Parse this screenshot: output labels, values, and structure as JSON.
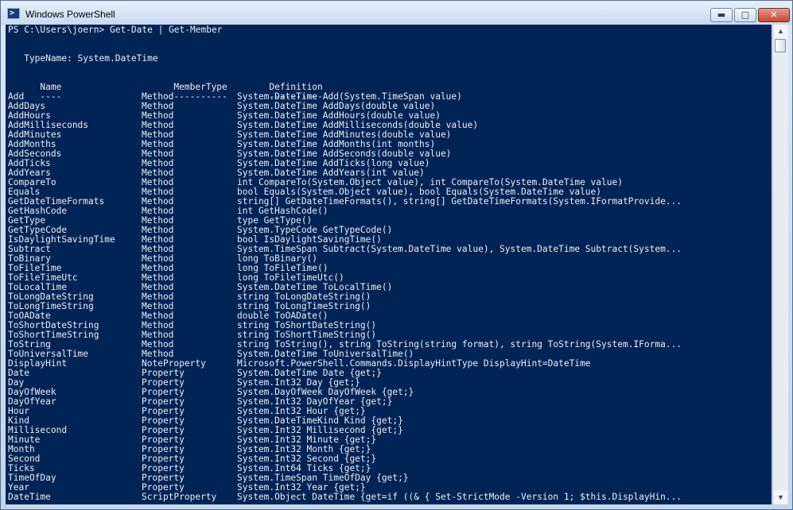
{
  "window": {
    "title": "Windows PowerShell",
    "icon": "powershell-icon",
    "controls": {
      "minimize": "▬",
      "maximize": "□",
      "close": "✕"
    }
  },
  "console": {
    "prompt": "PS C:\\Users\\joern> Get-Date | Get-Member",
    "typename": "   TypeName: System.DateTime",
    "headers": [
      "Name",
      "MemberType",
      "Definition"
    ],
    "underline": [
      "----",
      "----------",
      "----------"
    ],
    "rows": [
      [
        "Add",
        "Method",
        "System.DateTime Add(System.TimeSpan value)"
      ],
      [
        "AddDays",
        "Method",
        "System.DateTime AddDays(double value)"
      ],
      [
        "AddHours",
        "Method",
        "System.DateTime AddHours(double value)"
      ],
      [
        "AddMilliseconds",
        "Method",
        "System.DateTime AddMilliseconds(double value)"
      ],
      [
        "AddMinutes",
        "Method",
        "System.DateTime AddMinutes(double value)"
      ],
      [
        "AddMonths",
        "Method",
        "System.DateTime AddMonths(int months)"
      ],
      [
        "AddSeconds",
        "Method",
        "System.DateTime AddSeconds(double value)"
      ],
      [
        "AddTicks",
        "Method",
        "System.DateTime AddTicks(long value)"
      ],
      [
        "AddYears",
        "Method",
        "System.DateTime AddYears(int value)"
      ],
      [
        "CompareTo",
        "Method",
        "int CompareTo(System.Object value), int CompareTo(System.DateTime value)"
      ],
      [
        "Equals",
        "Method",
        "bool Equals(System.Object value), bool Equals(System.DateTime value)"
      ],
      [
        "GetDateTimeFormats",
        "Method",
        "string[] GetDateTimeFormats(), string[] GetDateTimeFormats(System.IFormatProvide..."
      ],
      [
        "GetHashCode",
        "Method",
        "int GetHashCode()"
      ],
      [
        "GetType",
        "Method",
        "type GetType()"
      ],
      [
        "GetTypeCode",
        "Method",
        "System.TypeCode GetTypeCode()"
      ],
      [
        "IsDaylightSavingTime",
        "Method",
        "bool IsDaylightSavingTime()"
      ],
      [
        "Subtract",
        "Method",
        "System.TimeSpan Subtract(System.DateTime value), System.DateTime Subtract(System..."
      ],
      [
        "ToBinary",
        "Method",
        "long ToBinary()"
      ],
      [
        "ToFileTime",
        "Method",
        "long ToFileTime()"
      ],
      [
        "ToFileTimeUtc",
        "Method",
        "long ToFileTimeUtc()"
      ],
      [
        "ToLocalTime",
        "Method",
        "System.DateTime ToLocalTime()"
      ],
      [
        "ToLongDateString",
        "Method",
        "string ToLongDateString()"
      ],
      [
        "ToLongTimeString",
        "Method",
        "string ToLongTimeString()"
      ],
      [
        "ToOADate",
        "Method",
        "double ToOADate()"
      ],
      [
        "ToShortDateString",
        "Method",
        "string ToShortDateString()"
      ],
      [
        "ToShortTimeString",
        "Method",
        "string ToShortTimeString()"
      ],
      [
        "ToString",
        "Method",
        "string ToString(), string ToString(string format), string ToString(System.IForma..."
      ],
      [
        "ToUniversalTime",
        "Method",
        "System.DateTime ToUniversalTime()"
      ],
      [
        "DisplayHint",
        "NoteProperty",
        "Microsoft.PowerShell.Commands.DisplayHintType DisplayHint=DateTime"
      ],
      [
        "Date",
        "Property",
        "System.DateTime Date {get;}"
      ],
      [
        "Day",
        "Property",
        "System.Int32 Day {get;}"
      ],
      [
        "DayOfWeek",
        "Property",
        "System.DayOfWeek DayOfWeek {get;}"
      ],
      [
        "DayOfYear",
        "Property",
        "System.Int32 DayOfYear {get;}"
      ],
      [
        "Hour",
        "Property",
        "System.Int32 Hour {get;}"
      ],
      [
        "Kind",
        "Property",
        "System.DateTimeKind Kind {get;}"
      ],
      [
        "Millisecond",
        "Property",
        "System.Int32 Millisecond {get;}"
      ],
      [
        "Minute",
        "Property",
        "System.Int32 Minute {get;}"
      ],
      [
        "Month",
        "Property",
        "System.Int32 Month {get;}"
      ],
      [
        "Second",
        "Property",
        "System.Int32 Second {get;}"
      ],
      [
        "Ticks",
        "Property",
        "System.Int64 Ticks {get;}"
      ],
      [
        "TimeOfDay",
        "Property",
        "System.TimeSpan TimeOfDay {get;}"
      ],
      [
        "Year",
        "Property",
        "System.Int32 Year {get;}"
      ],
      [
        "DateTime",
        "ScriptProperty",
        "System.Object DateTime {get=if ((& { Set-StrictMode -Version 1; $this.DisplayHin..."
      ]
    ]
  },
  "scrollbar": {
    "up": "▲",
    "down": "▼"
  }
}
